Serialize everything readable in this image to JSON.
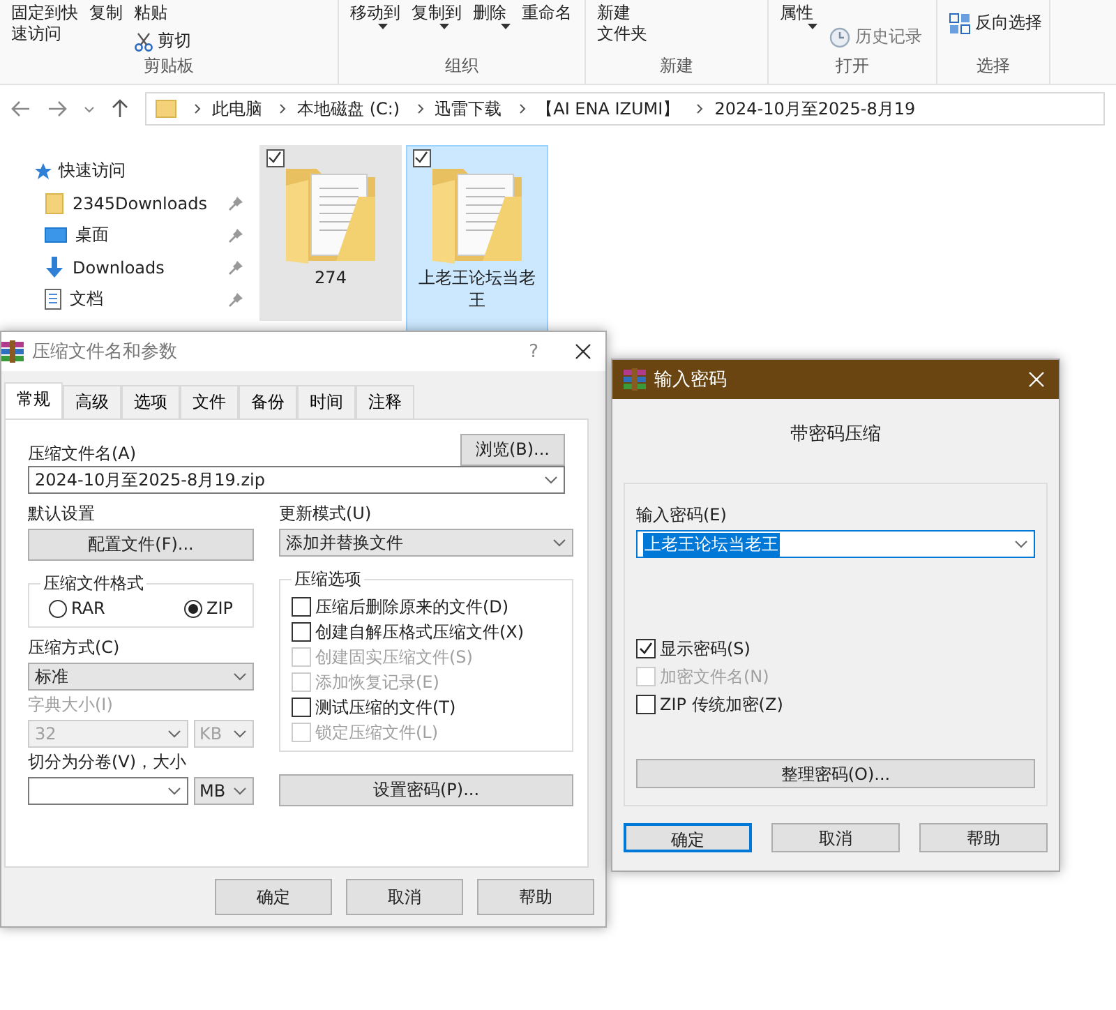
{
  "ribbon": {
    "groups": [
      {
        "label": "剪贴板",
        "columns": [
          [
            {
              "kind": "text",
              "lines": [
                "固定到快",
                "速访问"
              ]
            }
          ],
          [
            {
              "kind": "text",
              "lines": [
                "复制"
              ]
            }
          ],
          [
            {
              "kind": "text",
              "lines": [
                "粘贴"
              ]
            },
            {
              "kind": "scissors",
              "lines": [
                "剪切"
              ]
            }
          ]
        ]
      },
      {
        "label": "组织",
        "columns": [
          [
            {
              "kind": "caret",
              "lines": [
                "移动到"
              ]
            }
          ],
          [
            {
              "kind": "caret",
              "lines": [
                "复制到"
              ]
            }
          ],
          [
            {
              "kind": "caret",
              "lines": [
                "删除"
              ]
            }
          ],
          [
            {
              "kind": "text",
              "lines": [
                "重命名"
              ]
            }
          ]
        ]
      },
      {
        "label": "新建",
        "columns": [
          [
            {
              "kind": "text",
              "lines": [
                "新建",
                "文件夹"
              ]
            }
          ]
        ]
      },
      {
        "label": "打开",
        "columns": [
          [
            {
              "kind": "caret",
              "lines": [
                "属性"
              ]
            }
          ],
          [
            {
              "kind": "history",
              "lines": [
                "历史记录"
              ]
            }
          ]
        ]
      },
      {
        "label": "选择",
        "columns": [
          [
            {
              "kind": "invert",
              "lines": [
                "反向选择"
              ]
            }
          ]
        ]
      }
    ]
  },
  "address": {
    "crumbs": [
      "此电脑",
      "本地磁盘 (C:)",
      "迅雷下载",
      "【AI ENA IZUMI】",
      "2024-10月至2025-8月19"
    ]
  },
  "nav": {
    "header": "快速访问",
    "items": [
      {
        "kind": "folder",
        "label": "2345Downloads",
        "pinned": true
      },
      {
        "kind": "desktop",
        "label": "桌面",
        "pinned": true
      },
      {
        "kind": "download",
        "label": "Downloads",
        "pinned": true
      },
      {
        "kind": "document",
        "label": "文档",
        "pinned": true
      }
    ]
  },
  "folders": [
    {
      "name": "274",
      "checked": true,
      "selected": false,
      "hovered": true
    },
    {
      "name": "上老王论坛当老王",
      "checked": true,
      "selected": true,
      "hovered": false
    }
  ],
  "archive_dialog": {
    "title": "压缩文件名和参数",
    "help": "?",
    "tabs": [
      {
        "label": "常规",
        "selected": true
      },
      {
        "label": "高级",
        "selected": false
      },
      {
        "label": "选项",
        "selected": false
      },
      {
        "label": "文件",
        "selected": false
      },
      {
        "label": "备份",
        "selected": false
      },
      {
        "label": "时间",
        "selected": false
      },
      {
        "label": "注释",
        "selected": false
      }
    ],
    "archive_name": {
      "label": "压缩文件名(A)",
      "value": "2024-10月至2025-8月19.zip",
      "browse": "浏览(B)..."
    },
    "profile": {
      "label": "默认设置",
      "button": "配置文件(F)..."
    },
    "update_mode": {
      "label": "更新模式(U)",
      "value": "添加并替换文件"
    },
    "format": {
      "legend": "压缩文件格式",
      "options": [
        {
          "label": "RAR",
          "selected": false
        },
        {
          "label": "ZIP",
          "selected": true
        }
      ]
    },
    "method": {
      "label": "压缩方式(C)",
      "value": "标准"
    },
    "dictionary": {
      "label": "字典大小(I)",
      "value": "32",
      "unit": "KB",
      "disabled": true
    },
    "split": {
      "label": "切分为分卷(V)，大小",
      "unit": "MB"
    },
    "options": {
      "legend": "压缩选项",
      "items": [
        {
          "label": "压缩后删除原来的文件(D)",
          "checked": false,
          "disabled": false
        },
        {
          "label": "创建自解压格式压缩文件(X)",
          "checked": false,
          "disabled": false
        },
        {
          "label": "创建固实压缩文件(S)",
          "checked": false,
          "disabled": true
        },
        {
          "label": "添加恢复记录(E)",
          "checked": false,
          "disabled": true
        },
        {
          "label": "测试压缩的文件(T)",
          "checked": false,
          "disabled": false
        },
        {
          "label": "锁定压缩文件(L)",
          "checked": false,
          "disabled": true
        }
      ]
    },
    "password_button": "设置密码(P)...",
    "buttons": [
      {
        "label": "确定",
        "default": false
      },
      {
        "label": "取消",
        "default": false
      },
      {
        "label": "帮助",
        "default": false
      }
    ]
  },
  "password_dialog": {
    "title": "输入密码",
    "heading": "带密码压缩",
    "field_label": "输入密码(E)",
    "value": "上老王论坛当老王",
    "highlighted": true,
    "checkboxes": [
      {
        "label": "显示密码(S)",
        "checked": true,
        "disabled": false
      },
      {
        "label": "加密文件名(N)",
        "checked": false,
        "disabled": true
      },
      {
        "label": "ZIP 传统加密(Z)",
        "checked": false,
        "disabled": false
      }
    ],
    "organize_button": "整理密码(O)...",
    "buttons": [
      {
        "label": "确定",
        "default": true
      },
      {
        "label": "取消",
        "default": false
      },
      {
        "label": "帮助",
        "default": false
      }
    ]
  }
}
